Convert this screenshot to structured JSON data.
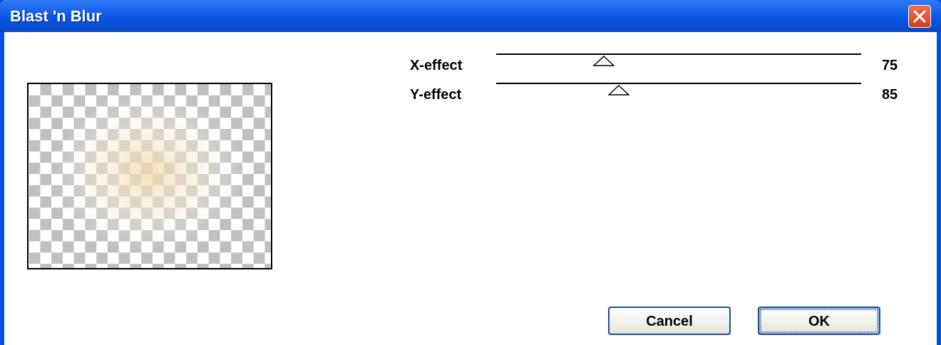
{
  "window": {
    "title": "Blast 'n Blur"
  },
  "sliders": [
    {
      "label": "X-effect",
      "level": 0.295,
      "reading": "75"
    },
    {
      "label": "Y-effect",
      "level": 0.336,
      "reading": "85"
    }
  ],
  "buttons": [
    {
      "label": "Cancel",
      "focused": false
    },
    {
      "label": "OK",
      "focused": true
    }
  ]
}
